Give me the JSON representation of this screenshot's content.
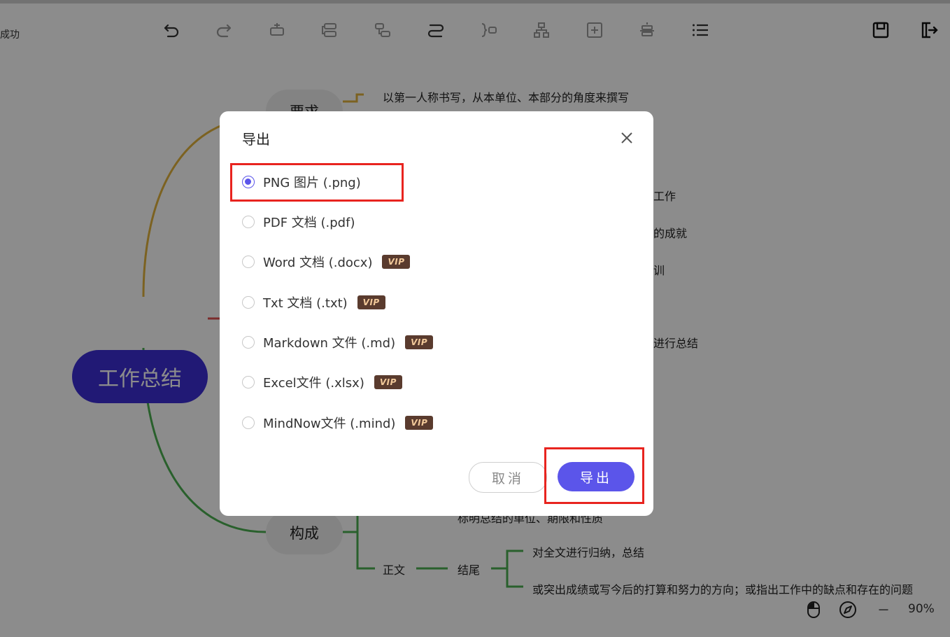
{
  "toolbar": {
    "status_text": "成功",
    "buttons": [
      {
        "icon": "undo-icon"
      },
      {
        "icon": "redo-icon"
      },
      {
        "icon": "insert-sibling-icon"
      },
      {
        "icon": "insert-child-icon"
      },
      {
        "icon": "insert-parent-icon"
      },
      {
        "icon": "connect-icon"
      },
      {
        "icon": "summary-icon"
      },
      {
        "icon": "structure-icon"
      },
      {
        "icon": "add-node-icon"
      },
      {
        "icon": "align-icon"
      },
      {
        "icon": "outline-icon"
      },
      {
        "icon": "save-icon"
      },
      {
        "icon": "export-icon"
      }
    ]
  },
  "mindmap": {
    "central": "工作总结",
    "branch_top": "要求",
    "branch_bottom": "构成",
    "items": [
      "以第一人称书写，从本单位、本部分的角度来撰写",
      "工作",
      "的成就",
      "训",
      "进行总结",
      "标明总结的单位、期限和性质",
      "正文",
      "结尾",
      "对全文进行归纳，总结",
      "或突出成绩或写今后的打算和努力的方向；或指出工作中的缺点和存在的问题"
    ],
    "colors": {
      "central": "#3c2fd6",
      "branch_top_line": "#e2b33c",
      "branch_bottom_line": "#4caf50",
      "mid_line": "#e05050"
    }
  },
  "bottom_bar": {
    "zoom": "90%",
    "zoom_out_label": "－",
    "icons": [
      "mouse-icon",
      "locate-icon"
    ]
  },
  "dialog": {
    "title": "导出",
    "options": [
      {
        "label": "PNG 图片 (.png)",
        "checked": true,
        "vip": false
      },
      {
        "label": "PDF 文档 (.pdf)",
        "checked": false,
        "vip": false
      },
      {
        "label": "Word 文档 (.docx)",
        "checked": false,
        "vip": true
      },
      {
        "label": "Txt 文档 (.txt)",
        "checked": false,
        "vip": true
      },
      {
        "label": "Markdown 文件 (.md)",
        "checked": false,
        "vip": true
      },
      {
        "label": "Excel文件 (.xlsx)",
        "checked": false,
        "vip": true
      },
      {
        "label": "MindNow文件 (.mind)",
        "checked": false,
        "vip": true
      }
    ],
    "vip_badge": "VIP",
    "cancel_label": "取消",
    "export_label": "导出",
    "accent_color": "#5b55ea",
    "highlight_color": "#e8241f"
  }
}
